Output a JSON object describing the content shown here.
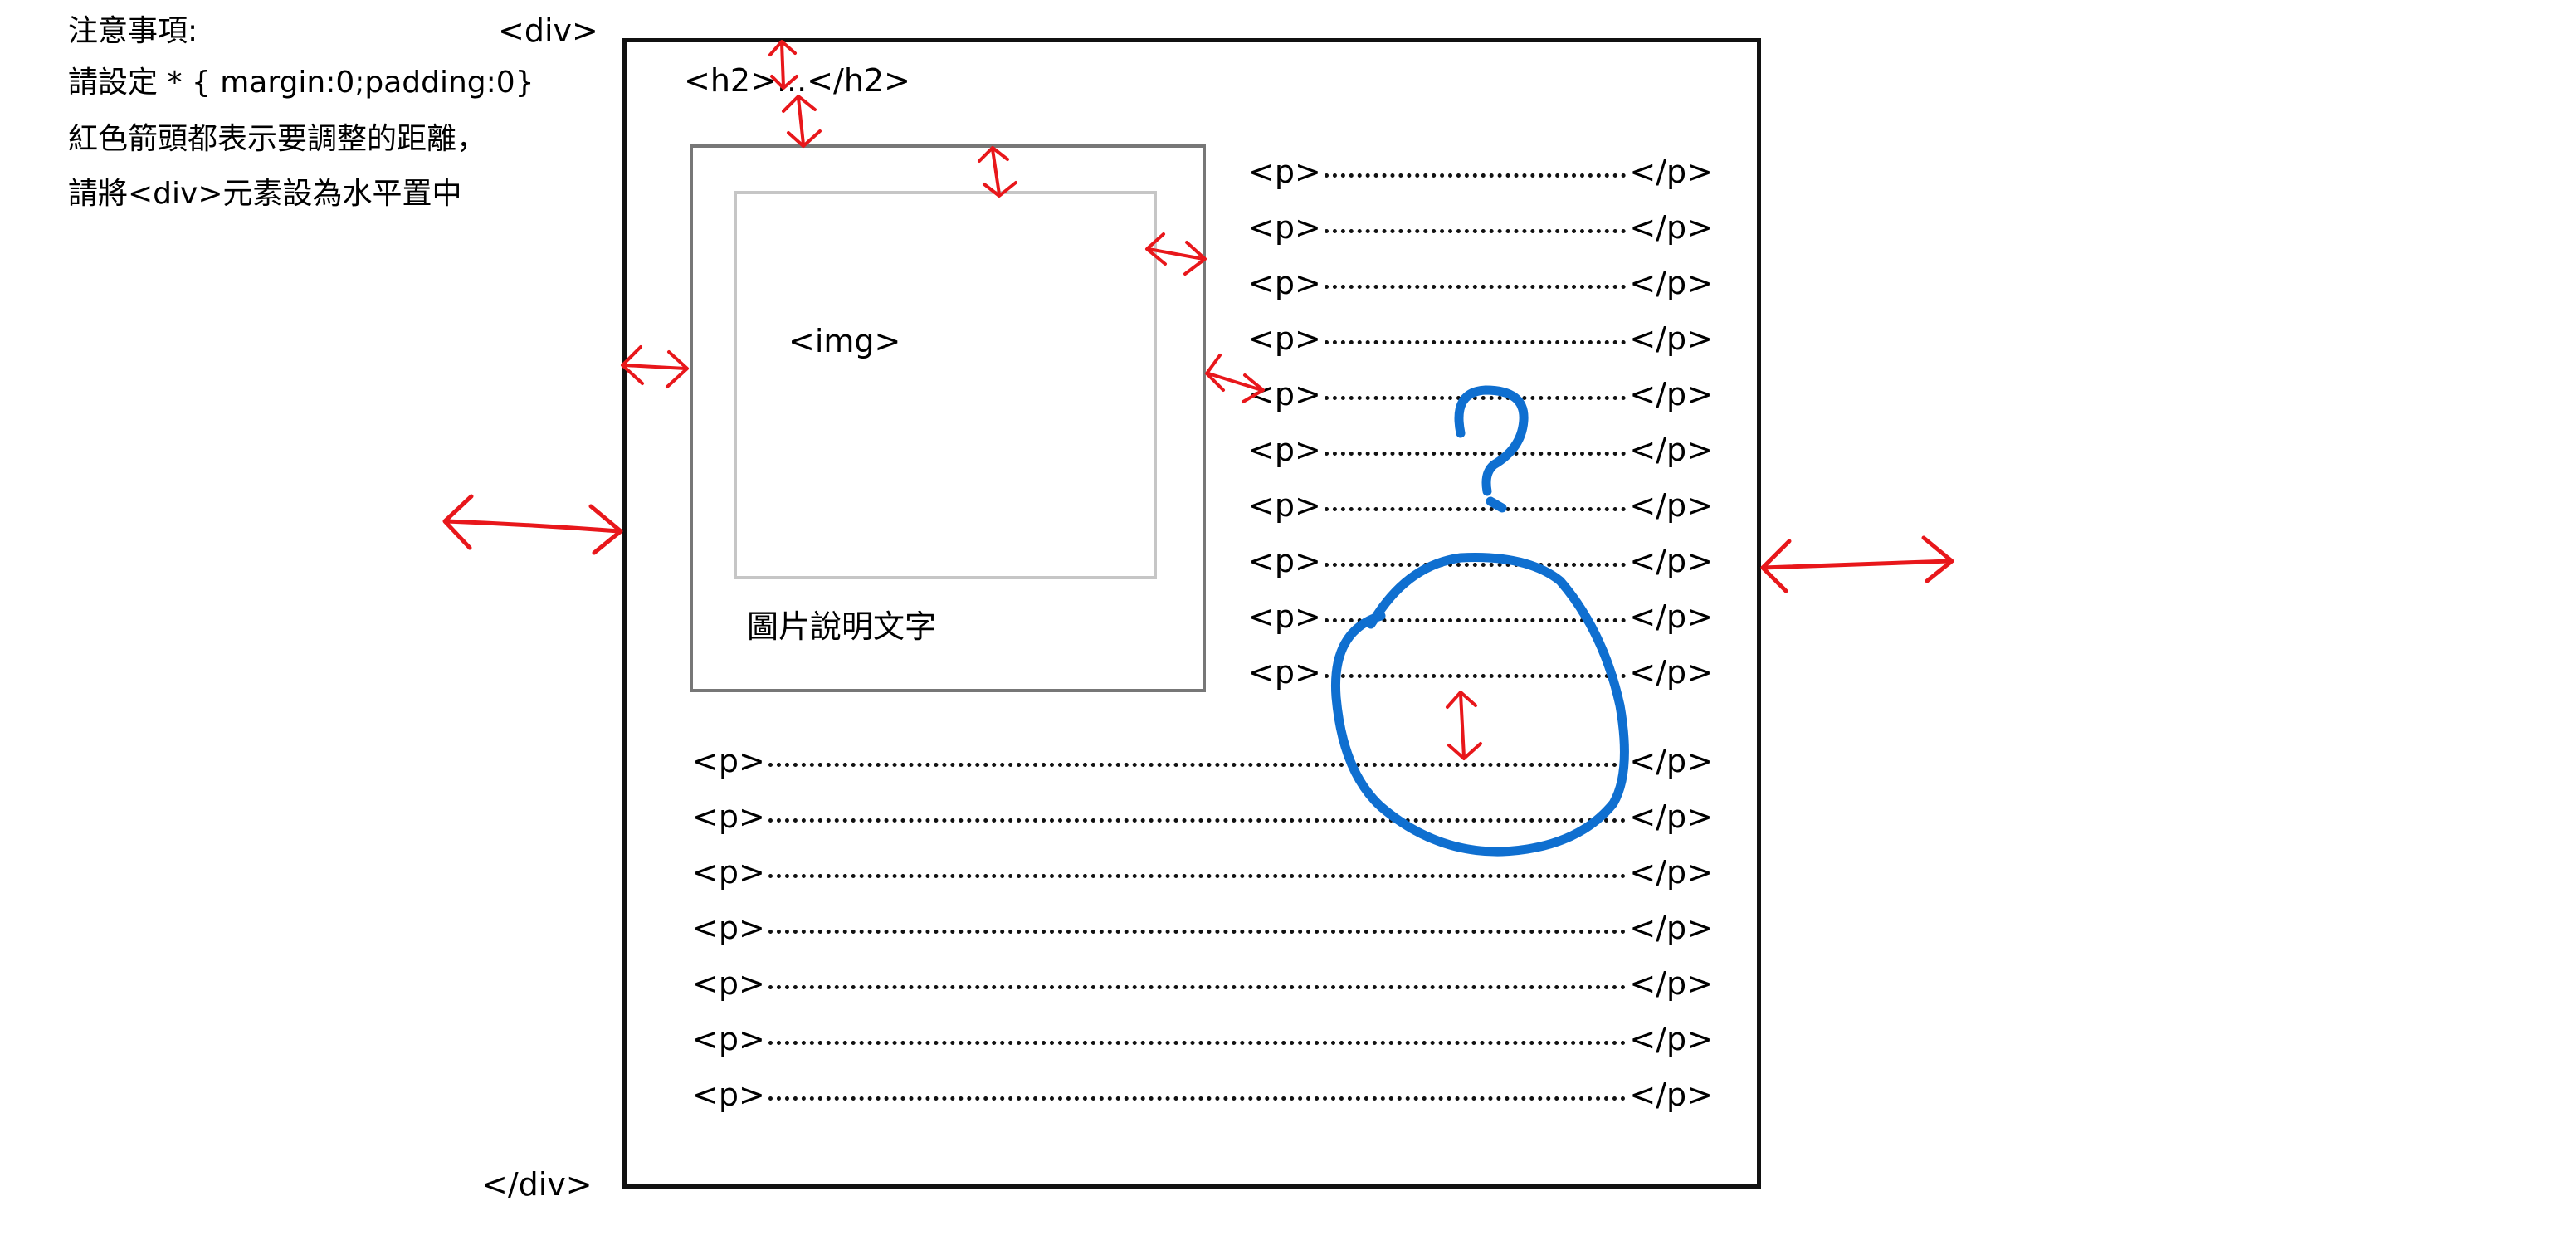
{
  "notes": {
    "title": "注意事項:",
    "line1": "請設定 * { margin:0;padding:0}",
    "line2": "紅色箭頭都表示要調整的距離，",
    "line3": "請將<div>元素設為水平置中"
  },
  "labels": {
    "div_open": "<div>",
    "div_close": "</div>",
    "h2": "<h2>...</h2>",
    "img": "<img>",
    "caption": "圖片說明文字",
    "question": "?"
  },
  "p_tags": {
    "open": "<p>",
    "close": "</p>"
  },
  "paragraphs": {
    "beside_image_count": 10,
    "below_image_count": 7
  },
  "colors": {
    "arrow": "#e8171b",
    "annotation": "#0f6fd0",
    "outer_border": "#111111",
    "figure_border": "#777777",
    "image_border": "#c6c6c6"
  }
}
